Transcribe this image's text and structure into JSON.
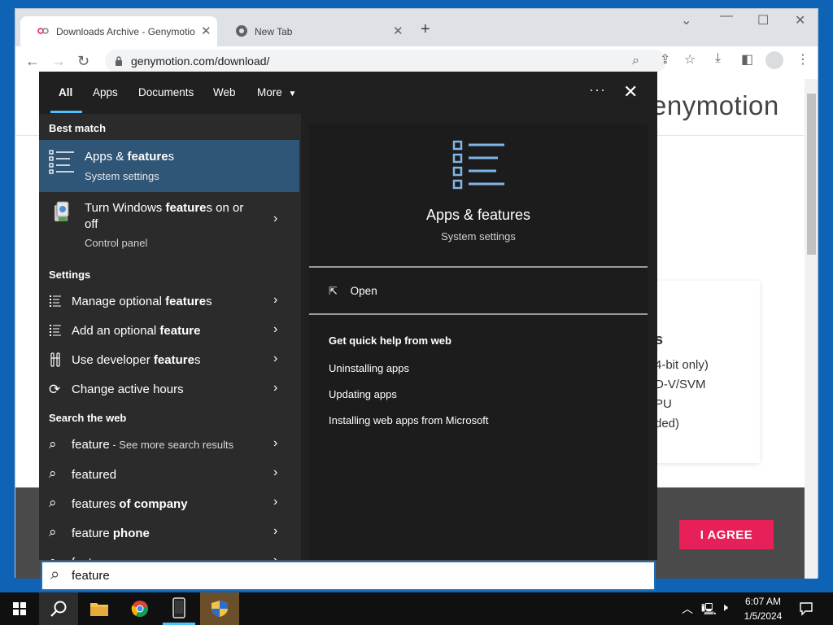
{
  "browser": {
    "tabs": [
      {
        "title": "Downloads Archive - Genymotio",
        "active": true
      },
      {
        "title": "New Tab",
        "active": false
      }
    ],
    "url": "genymotion.com/download/"
  },
  "page": {
    "logo": "enymotion",
    "requirements_heading": "s",
    "requirements": [
      "4-bit only)",
      "D-V/SVM",
      "PU",
      "ded)"
    ],
    "agree_label": "I AGREE"
  },
  "search": {
    "filters": [
      "All",
      "Apps",
      "Documents",
      "Web",
      "More"
    ],
    "selected_filter": "All",
    "best_match_heading": "Best match",
    "best_match": {
      "title_plain": "Apps & ",
      "title_bold": "feature",
      "title_tail": "s",
      "subtitle": "System settings"
    },
    "control_item": {
      "line1_plain": "Turn Windows ",
      "line1_bold": "feature",
      "line1_tail": "s on or",
      "line2": "off",
      "subtitle": "Control panel"
    },
    "settings_heading": "Settings",
    "settings_items": [
      {
        "plain": "Manage optional ",
        "bold": "feature",
        "tail": "s",
        "icon": "list-icon"
      },
      {
        "plain": "Add an optional ",
        "bold": "feature",
        "tail": "",
        "icon": "list-icon"
      },
      {
        "plain": "Use developer ",
        "bold": "feature",
        "tail": "s",
        "icon": "tools-icon"
      },
      {
        "plain": "Change active hours",
        "bold": "",
        "tail": "",
        "icon": "sync-icon"
      }
    ],
    "web_heading": "Search the web",
    "web_items": [
      {
        "text": "feature",
        "bold": "",
        "suffix": " - See more search results"
      },
      {
        "text": "featured",
        "bold": "",
        "suffix": ""
      },
      {
        "text": "features",
        "bold": " of company",
        "suffix": ""
      },
      {
        "text": "feature",
        "bold": " phone",
        "suffix": ""
      },
      {
        "text": "feat",
        "bold": "",
        "suffix": ""
      }
    ],
    "detail": {
      "title": "Apps & features",
      "subtitle": "System settings",
      "open_label": "Open",
      "help_heading": "Get quick help from web",
      "help_links": [
        "Uninstalling apps",
        "Updating apps",
        "Installing web apps from Microsoft"
      ]
    },
    "query": "feature"
  },
  "taskbar": {
    "time": "6:07 AM",
    "date": "1/5/2024"
  },
  "colors": {
    "accent": "#4cc2ff",
    "selection": "#2f5577",
    "agree": "#e8205a",
    "desktop": "#0f63b5"
  }
}
